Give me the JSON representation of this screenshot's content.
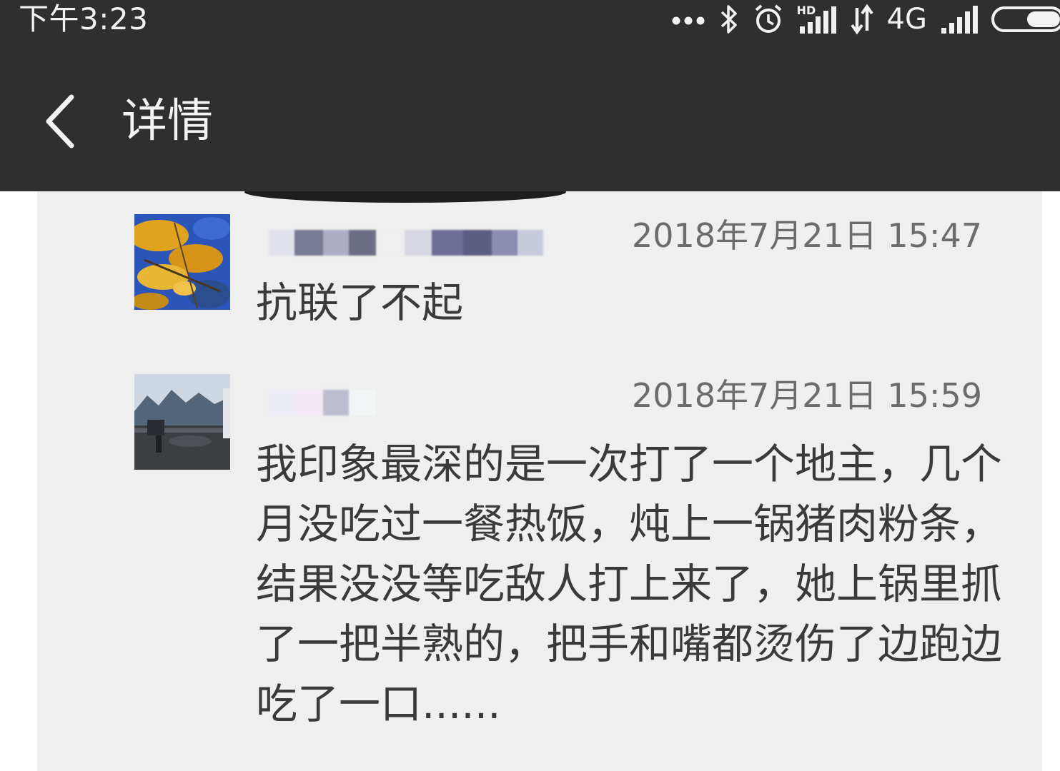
{
  "status_bar": {
    "time": "下午3:23",
    "network": "4G",
    "hd_label": "HD",
    "icons": [
      "more-dots-icon",
      "bluetooth-icon",
      "alarm-icon",
      "hd-signal-icon",
      "data-transfer-icon",
      "cell-signal-icon",
      "battery-icon"
    ]
  },
  "header": {
    "title": "详情",
    "back_icon": "back-chevron-icon"
  },
  "comments": [
    {
      "name_redacted": true,
      "timestamp": "2018年7月21日 15:47",
      "text": "抗联了不起"
    },
    {
      "name_redacted": true,
      "timestamp": "2018年7月21日 15:59",
      "text": "我印象最深的是一次打了一个地主，几个月没吃过一餐热饭，炖上一锅猪肉粉条，结果没没等吃敌人打上来了，她上锅里抓了一把半熟的，把手和嘴都烫伤了边跑边吃了一口......"
    }
  ],
  "colors": {
    "bar_background": "#2f2f2f",
    "card_background": "#efefef",
    "timestamp_text": "#6c6c6c",
    "comment_text": "#3a3a3a"
  }
}
